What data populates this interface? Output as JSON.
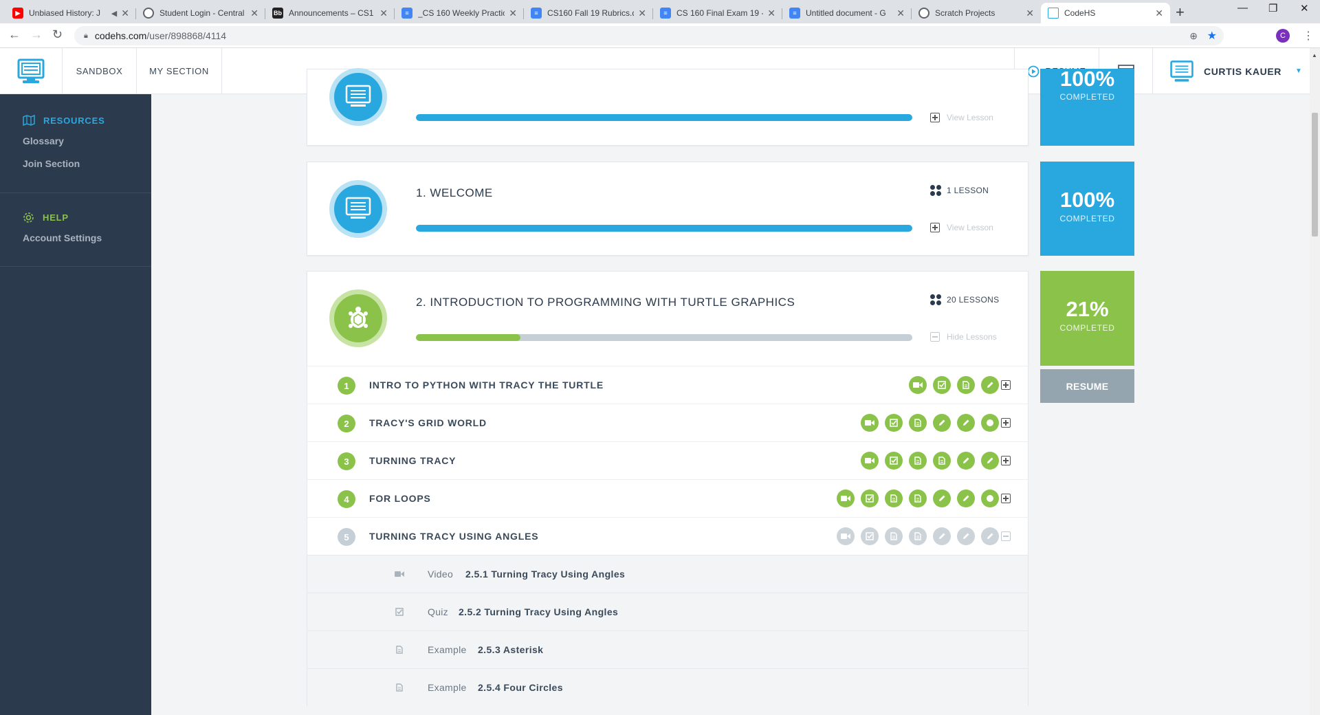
{
  "browser": {
    "tabs": [
      {
        "title": "Unbiased History: J",
        "favicon": "youtube-icon",
        "color": "#ff0000"
      },
      {
        "title": "Student Login - Central",
        "favicon": "globe-icon",
        "color": "#5f6368"
      },
      {
        "title": "Announcements – CS1",
        "favicon": "blackboard-icon",
        "color": "#222222"
      },
      {
        "title": "_CS 160 Weekly Practic",
        "favicon": "docs-icon",
        "color": "#4285f4"
      },
      {
        "title": "CS160 Fall 19 Rubrics.d",
        "favicon": "docs-icon",
        "color": "#4285f4"
      },
      {
        "title": "CS 160 Final Exam 19 -",
        "favicon": "docs-icon",
        "color": "#4285f4"
      },
      {
        "title": "Untitled document - G",
        "favicon": "docs-icon",
        "color": "#4285f4"
      },
      {
        "title": "Scratch Projects",
        "favicon": "globe-icon",
        "color": "#5f6368"
      },
      {
        "title": "CodeHS",
        "favicon": "codehs-icon",
        "color": "#29a8e0"
      }
    ],
    "url_host": "codehs.com",
    "url_path": "/user/898868/4114",
    "profile_initial": "C"
  },
  "header": {
    "nav": [
      "SANDBOX",
      "MY SECTION"
    ],
    "resume_label": "RESUME",
    "user_name": "CURTIS KAUER"
  },
  "sidebar": {
    "resources_label": "RESOURCES",
    "resources_links": [
      "Glossary",
      "Join Section"
    ],
    "help_label": "HELP",
    "help_links": [
      "Account Settings"
    ]
  },
  "modules": [
    {
      "title": "",
      "lessons": "",
      "action": "View Lesson",
      "percent": "100%",
      "completed_label": "COMPLETED",
      "progress": 1.0,
      "color": "#29a8e0"
    },
    {
      "title": "1. WELCOME",
      "lessons": "1 LESSON",
      "action": "View Lesson",
      "percent": "100%",
      "completed_label": "COMPLETED",
      "progress": 1.0,
      "color": "#29a8e0"
    },
    {
      "title": "2. INTRODUCTION TO PROGRAMMING WITH TURTLE GRAPHICS",
      "lessons": "20 LESSONS",
      "action": "Hide Lessons",
      "percent": "21%",
      "completed_label": "COMPLETED",
      "progress": 0.21,
      "color": "#8bc34a",
      "resume_label": "RESUME"
    }
  ],
  "lessons": [
    {
      "num": "1",
      "title": "INTRO TO PYTHON WITH TRACY THE TURTLE",
      "state": "done",
      "icons": [
        "video-icon",
        "quiz-check-icon",
        "document-icon",
        "pencil-icon"
      ]
    },
    {
      "num": "2",
      "title": "TRACY'S GRID WORLD",
      "state": "done",
      "icons": [
        "video-icon",
        "quiz-check-icon",
        "document-icon",
        "pencil-icon",
        "pencil-icon",
        "circle-icon"
      ]
    },
    {
      "num": "3",
      "title": "TURNING TRACY",
      "state": "done",
      "icons": [
        "video-icon",
        "quiz-check-icon",
        "document-icon",
        "document-icon",
        "pencil-icon",
        "pencil-icon"
      ]
    },
    {
      "num": "4",
      "title": "FOR LOOPS",
      "state": "done",
      "icons": [
        "video-icon",
        "quiz-check-icon",
        "document-icon",
        "document-icon",
        "pencil-icon",
        "pencil-icon",
        "circle-icon"
      ]
    },
    {
      "num": "5",
      "title": "TURNING TRACY USING ANGLES",
      "state": "open",
      "icons": [
        "video-icon",
        "quiz-check-icon",
        "document-icon",
        "document-icon",
        "pencil-icon",
        "pencil-icon",
        "pencil-icon"
      ]
    }
  ],
  "activities": [
    {
      "type": "Video",
      "name": "2.5.1 Turning Tracy Using Angles",
      "icon": "video-icon"
    },
    {
      "type": "Quiz",
      "name": "2.5.2 Turning Tracy Using Angles",
      "icon": "quiz-check-icon"
    },
    {
      "type": "Example",
      "name": "2.5.3 Asterisk",
      "icon": "document-icon"
    },
    {
      "type": "Example",
      "name": "2.5.4 Four Circles",
      "icon": "document-icon"
    }
  ]
}
